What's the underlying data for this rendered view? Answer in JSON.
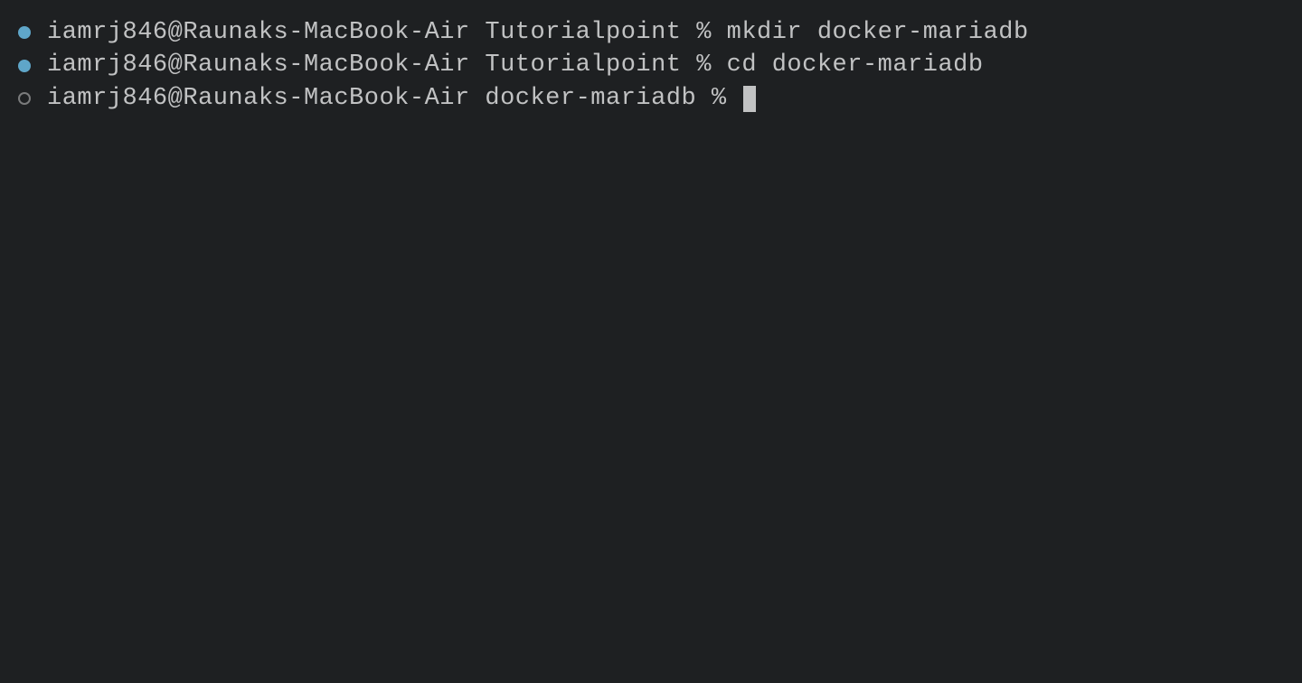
{
  "terminal": {
    "lines": [
      {
        "bullet_type": "filled",
        "prompt": "iamrj846@Raunaks-MacBook-Air Tutorialpoint % ",
        "command": "mkdir docker-mariadb",
        "has_cursor": false
      },
      {
        "bullet_type": "filled",
        "prompt": "iamrj846@Raunaks-MacBook-Air Tutorialpoint % ",
        "command": "cd docker-mariadb",
        "has_cursor": false
      },
      {
        "bullet_type": "outline",
        "prompt": "iamrj846@Raunaks-MacBook-Air docker-mariadb % ",
        "command": "",
        "has_cursor": true
      }
    ]
  },
  "colors": {
    "background": "#1e2022",
    "foreground": "#c1c2c3",
    "bullet_filled": "#5fa6c9",
    "bullet_outline": "#7a7b7c"
  }
}
